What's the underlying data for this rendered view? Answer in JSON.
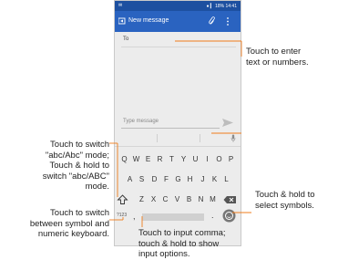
{
  "status_bar": {
    "left_text": "✉",
    "right_text": "● ▎ 18% 14:41"
  },
  "app_bar": {
    "title": "New message"
  },
  "to_field": {
    "label": "To"
  },
  "message_input": {
    "placeholder": "Type message"
  },
  "keyboard": {
    "row1": [
      "Q",
      "W",
      "E",
      "R",
      "T",
      "Y",
      "U",
      "I",
      "O",
      "P"
    ],
    "row2": [
      "A",
      "S",
      "D",
      "F",
      "G",
      "H",
      "J",
      "K",
      "L"
    ],
    "row3": [
      "Z",
      "X",
      "C",
      "V",
      "B",
      "N",
      "M"
    ],
    "symbol_key": "?123",
    "comma_key": ",",
    "period_key": "."
  },
  "callouts": {
    "enter_text": [
      "Touch to enter",
      "text or numbers."
    ],
    "abc_mode": [
      "Touch to switch",
      "\"abc/Abc\" mode;",
      "Touch & hold to",
      "switch \"abc/ABC\"",
      "mode."
    ],
    "symbol_keyboard": [
      "Touch to switch",
      "between symbol and",
      "numeric keyboard."
    ],
    "comma": [
      "Touch to input comma;",
      "touch & hold to show",
      "input options."
    ],
    "select_symbols": [
      "Touch & hold to",
      "select symbols."
    ]
  },
  "colors": {
    "status_bar": "#1d50a0",
    "app_bar": "#2a63c0",
    "callout_line": "#ef7d1c"
  }
}
